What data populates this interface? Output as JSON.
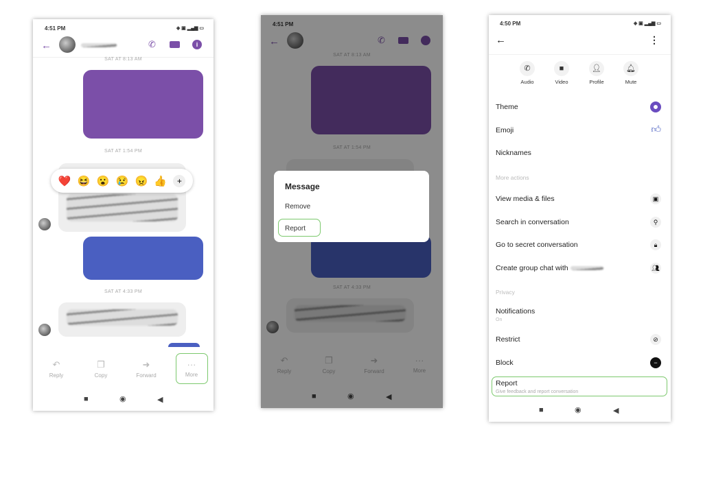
{
  "colors": {
    "accent": "#7b4fa8",
    "highlight": "#7bc86c",
    "outgoing_blue": "#4a5fc1"
  },
  "chat": {
    "status_time": "4:51 PM",
    "timestamps": [
      "SAT AT 8:13 AM",
      "SAT AT 1:54 PM",
      "SAT AT 4:33 PM"
    ],
    "reactions": [
      "❤️",
      "😆",
      "😮",
      "😢",
      "😠",
      "👍",
      "+"
    ],
    "actions": [
      {
        "label": "Reply",
        "icon": "reply-icon"
      },
      {
        "label": "Copy",
        "icon": "copy-icon"
      },
      {
        "label": "Forward",
        "icon": "forward-icon"
      },
      {
        "label": "More",
        "icon": "more-icon"
      }
    ]
  },
  "dialog": {
    "status_time": "4:51 PM",
    "timestamps": [
      "SAT AT 8:13 AM",
      "SAT AT 1:54 PM",
      "SAT AT 4:33 PM"
    ],
    "title": "Message",
    "options": [
      "Remove",
      "Report"
    ],
    "actions": [
      "Reply",
      "Copy",
      "Forward",
      "More"
    ]
  },
  "settings": {
    "status_time": "4:50 PM",
    "quick_actions": [
      {
        "label": "Audio",
        "icon": "phone-icon"
      },
      {
        "label": "Video",
        "icon": "video-icon"
      },
      {
        "label": "Profile",
        "icon": "profile-icon"
      },
      {
        "label": "Mute",
        "icon": "bell-icon"
      }
    ],
    "theme": "Theme",
    "emoji": "Emoji",
    "nicknames": "Nicknames",
    "more_actions_header": "More actions",
    "view_media": "View media & files",
    "search": "Search in conversation",
    "secret": "Go to secret conversation",
    "group": "Create group chat with",
    "privacy_header": "Privacy",
    "notifications": "Notifications",
    "notifications_value": "On",
    "restrict": "Restrict",
    "block": "Block",
    "report": "Report",
    "report_sub": "Give feedback and report conversation"
  }
}
